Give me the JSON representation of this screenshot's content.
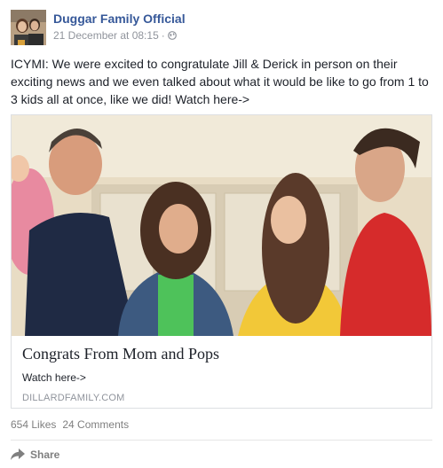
{
  "post": {
    "author": "Duggar Family Official",
    "date": "21 December at 08:15",
    "separator": "·",
    "text": "ICYMI: We were excited to congratulate Jill & Derick in person on their exciting news and we even talked about what it would be like to go from 1 to 3 kids all at once, like we did! Watch here->"
  },
  "link": {
    "title": "Congrats From Mom and Pops",
    "description": "Watch here->",
    "domain": "DILLARDFAMILY.COM"
  },
  "stats": {
    "likes": "654 Likes",
    "comments": "24 Comments"
  },
  "actions": {
    "share_label": "Share"
  },
  "colors": {
    "link_blue": "#365899",
    "meta_gray": "#90949c",
    "text": "#1d2129",
    "border": "#dddfe2"
  }
}
